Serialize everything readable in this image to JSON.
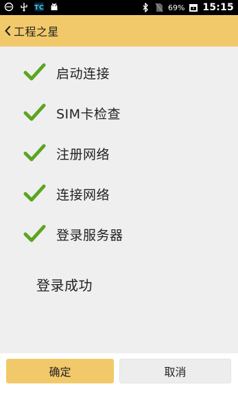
{
  "status_bar": {
    "battery": "69%",
    "time": "15:15",
    "left_icons": [
      "android-debug-icon",
      "usb-icon",
      "app-tc-icon",
      "android-icon"
    ],
    "right_icons": [
      "bluetooth-icon",
      "no-sim-icon",
      "battery-icon"
    ]
  },
  "app_bar": {
    "back_icon": "chevron-left-icon",
    "title": "工程之星",
    "background": "#f2c96a"
  },
  "steps": [
    {
      "label": "启动连接",
      "status": "done"
    },
    {
      "label": "SIM卡检查",
      "status": "done"
    },
    {
      "label": "注册网络",
      "status": "done"
    },
    {
      "label": "连接网络",
      "status": "done"
    },
    {
      "label": "登录服务器",
      "status": "done"
    }
  ],
  "check_color": "#5aa521",
  "result": "登录成功",
  "buttons": {
    "confirm": "确定",
    "cancel": "取消"
  }
}
